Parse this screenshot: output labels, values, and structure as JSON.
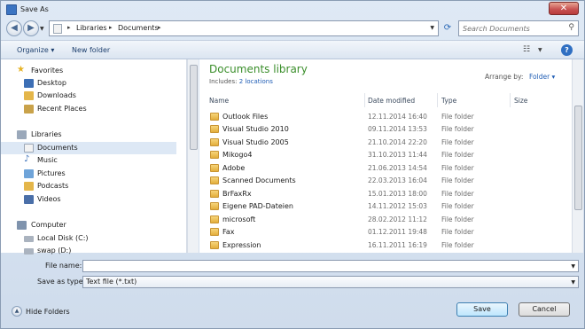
{
  "window": {
    "title": "Save As",
    "close_glyph": "✕"
  },
  "nav_buttons": {
    "back_icon": "arrow-left-icon",
    "forward_icon": "arrow-right-icon"
  },
  "address": {
    "breadcrumbs": [
      "Libraries",
      "Documents"
    ]
  },
  "search": {
    "placeholder": "Search Documents"
  },
  "toolbar": {
    "organize_label": "Organize ▾",
    "new_folder_label": "New folder"
  },
  "sidebar": {
    "favorites_label": "Favorites",
    "favorites": [
      "Desktop",
      "Downloads",
      "Recent Places"
    ],
    "libraries_label": "Libraries",
    "libraries": [
      "Documents",
      "Music",
      "Pictures",
      "Podcasts",
      "Videos"
    ],
    "computer_label": "Computer",
    "computer": [
      "Local Disk (C:)",
      "swap (D:)"
    ],
    "selected": "Documents"
  },
  "library": {
    "title": "Documents library",
    "includes_prefix": "Includes:",
    "includes_link": "2 locations",
    "arrange_label": "Arrange by:",
    "arrange_value": "Folder ▾"
  },
  "columns": {
    "name": "Name",
    "date": "Date modified",
    "type": "Type",
    "size": "Size"
  },
  "files": [
    {
      "name": "Outlook Files",
      "date": "12.11.2014 16:40",
      "type": "File folder"
    },
    {
      "name": "Visual Studio 2010",
      "date": "09.11.2014 13:53",
      "type": "File folder"
    },
    {
      "name": "Visual Studio 2005",
      "date": "21.10.2014 22:20",
      "type": "File folder"
    },
    {
      "name": "Mikogo4",
      "date": "31.10.2013 11:44",
      "type": "File folder"
    },
    {
      "name": "Adobe",
      "date": "21.06.2013 14:54",
      "type": "File folder"
    },
    {
      "name": "Scanned Documents",
      "date": "22.03.2013 16:04",
      "type": "File folder"
    },
    {
      "name": "BrFaxRx",
      "date": "15.01.2013 18:00",
      "type": "File folder"
    },
    {
      "name": "Eigene PAD-Dateien",
      "date": "14.11.2012 15:03",
      "type": "File folder"
    },
    {
      "name": "microsoft",
      "date": "28.02.2012 11:12",
      "type": "File folder"
    },
    {
      "name": "Fax",
      "date": "01.12.2011 19:48",
      "type": "File folder"
    },
    {
      "name": "Expression",
      "date": "16.11.2011 16:19",
      "type": "File folder"
    }
  ],
  "form": {
    "file_name_label": "File name:",
    "file_name_value": "",
    "save_type_label": "Save as type:",
    "save_type_value": "Text file (*.txt)"
  },
  "footer": {
    "hide_folders_label": "Hide Folders",
    "save_label": "Save",
    "cancel_label": "Cancel"
  },
  "colors": {
    "accent": "#3a8e2a",
    "link": "#1f5db5",
    "selection": "#dde8f5"
  }
}
